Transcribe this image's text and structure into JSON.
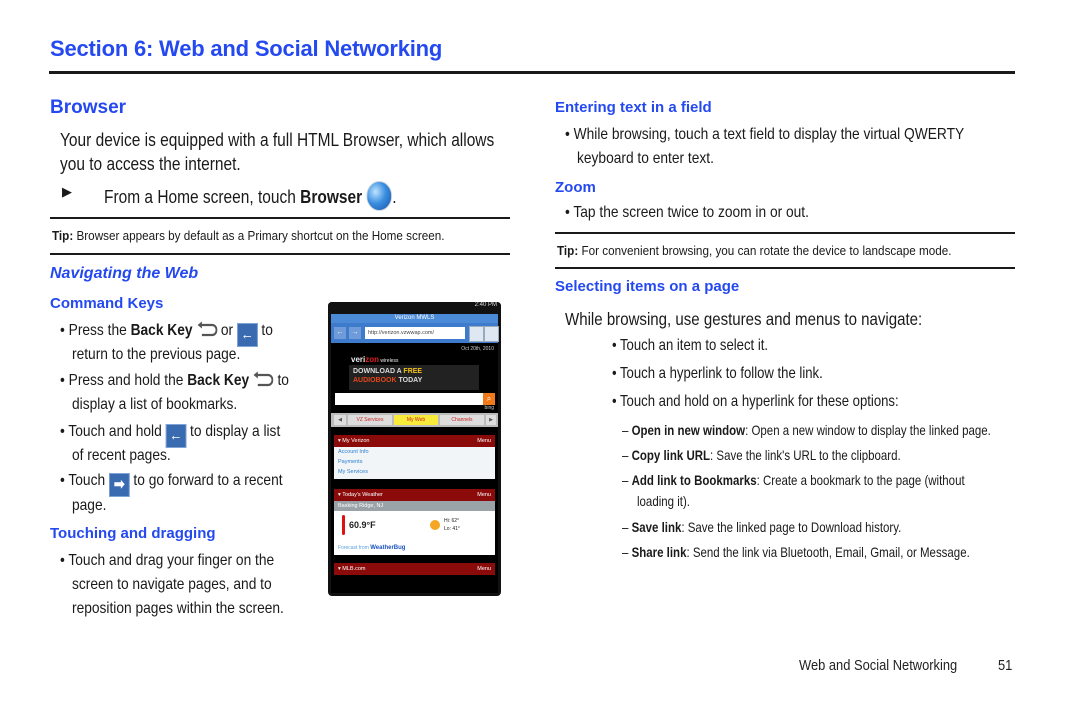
{
  "section_title": "Section 6: Web and Social Networking",
  "left": {
    "heading": "Browser",
    "intro_line1": "Your device is equipped with a full HTML Browser, which allows",
    "intro_line2": "you to access the internet.",
    "step_marker": "▶",
    "step_text": "From a Home screen, touch ",
    "step_bold": "Browser",
    "step_end": ".",
    "tip_label": "Tip:",
    "tip_text": " Browser appears by default as a Primary shortcut on the Home screen.",
    "nav_heading": "Navigating the Web",
    "command_keys_heading": "Command Keys",
    "ck": [
      {
        "pre": "• Press the ",
        "bold": "Back Key",
        "mid": " or ",
        "post": " to",
        "line2": "return to the previous page."
      },
      {
        "pre": "• Press and hold the ",
        "bold": "Back Key",
        "post": " to",
        "line2": "display a list of bookmarks."
      },
      {
        "pre": "• Touch and hold ",
        "post": " to display a list",
        "line2": "of recent pages."
      },
      {
        "pre": "• Touch ",
        "post": " to go forward to a recent",
        "line2": "page."
      }
    ],
    "touch_heading": "Touching and dragging",
    "touch_lines": [
      "• Touch and drag your finger on the",
      "screen to navigate pages, and to",
      "reposition pages within the screen."
    ]
  },
  "icons": {
    "back_arrow": "←",
    "forward_arrow": "➡"
  },
  "phone": {
    "status_time": "2:40 PM",
    "title": "Verizon MWLS",
    "url": "http://verizon.vzwwap.com/",
    "date": "Oct 20th, 2010",
    "logo_a": "veri",
    "logo_b": "zon",
    "logo_c": " wireless",
    "banner_l1": "DOWNLOAD A ",
    "banner_free": "FREE",
    "banner_l2a": "AUDIOBOOK",
    "banner_l2b": " TODAY",
    "bing": "bing",
    "tabs": [
      "◀",
      "VZ Services",
      "My Web",
      "Channels",
      "▶"
    ],
    "sect1": "▾ My Verizon",
    "menu": "Menu",
    "links": [
      "Account Info",
      "Payments",
      "My Services"
    ],
    "sect2": "▾ Today's Weather",
    "location": "Basking Ridge, NJ",
    "temp": "60.9°F",
    "hi": "Hi: 62°",
    "lo": "Lo: 41°",
    "forecast": "Forecast from ",
    "weatherbug": "WeatherBug",
    "sect3": "▾ MLB.com"
  },
  "right": {
    "entering_heading": "Entering text in a field",
    "entering_lines": [
      "• While browsing, touch a text field to display the virtual QWERTY",
      "keyboard to enter text."
    ],
    "zoom_heading": "Zoom",
    "zoom_line": "• Tap the screen twice to zoom in or out.",
    "tip_label": "Tip:",
    "tip_text": " For convenient browsing, you can rotate the device to landscape mode.",
    "selecting_heading": "Selecting items on a page",
    "selecting_intro": "While browsing, use gestures and menus to navigate:",
    "bullets": [
      "• Touch an item to select it.",
      "• Touch a hyperlink to follow the link.",
      "• Touch and hold on a hyperlink for these options:"
    ],
    "options": [
      {
        "bold": "Open in new window",
        "text": ": Open a new window to display the linked page."
      },
      {
        "bold": "Copy link URL",
        "text": ": Save the link's URL to the clipboard."
      },
      {
        "bold": "Add link to Bookmarks",
        "text": ": Create a bookmark to the page (without",
        "line2": "loading it)."
      },
      {
        "bold": "Save link",
        "text": ": Save the linked page to Download history."
      },
      {
        "bold": "Share link",
        "text": ": Send the link via Bluetooth, Email, Gmail, or Message."
      }
    ],
    "dash": "–"
  },
  "footer": {
    "label": "Web and Social Networking",
    "page": "51"
  }
}
